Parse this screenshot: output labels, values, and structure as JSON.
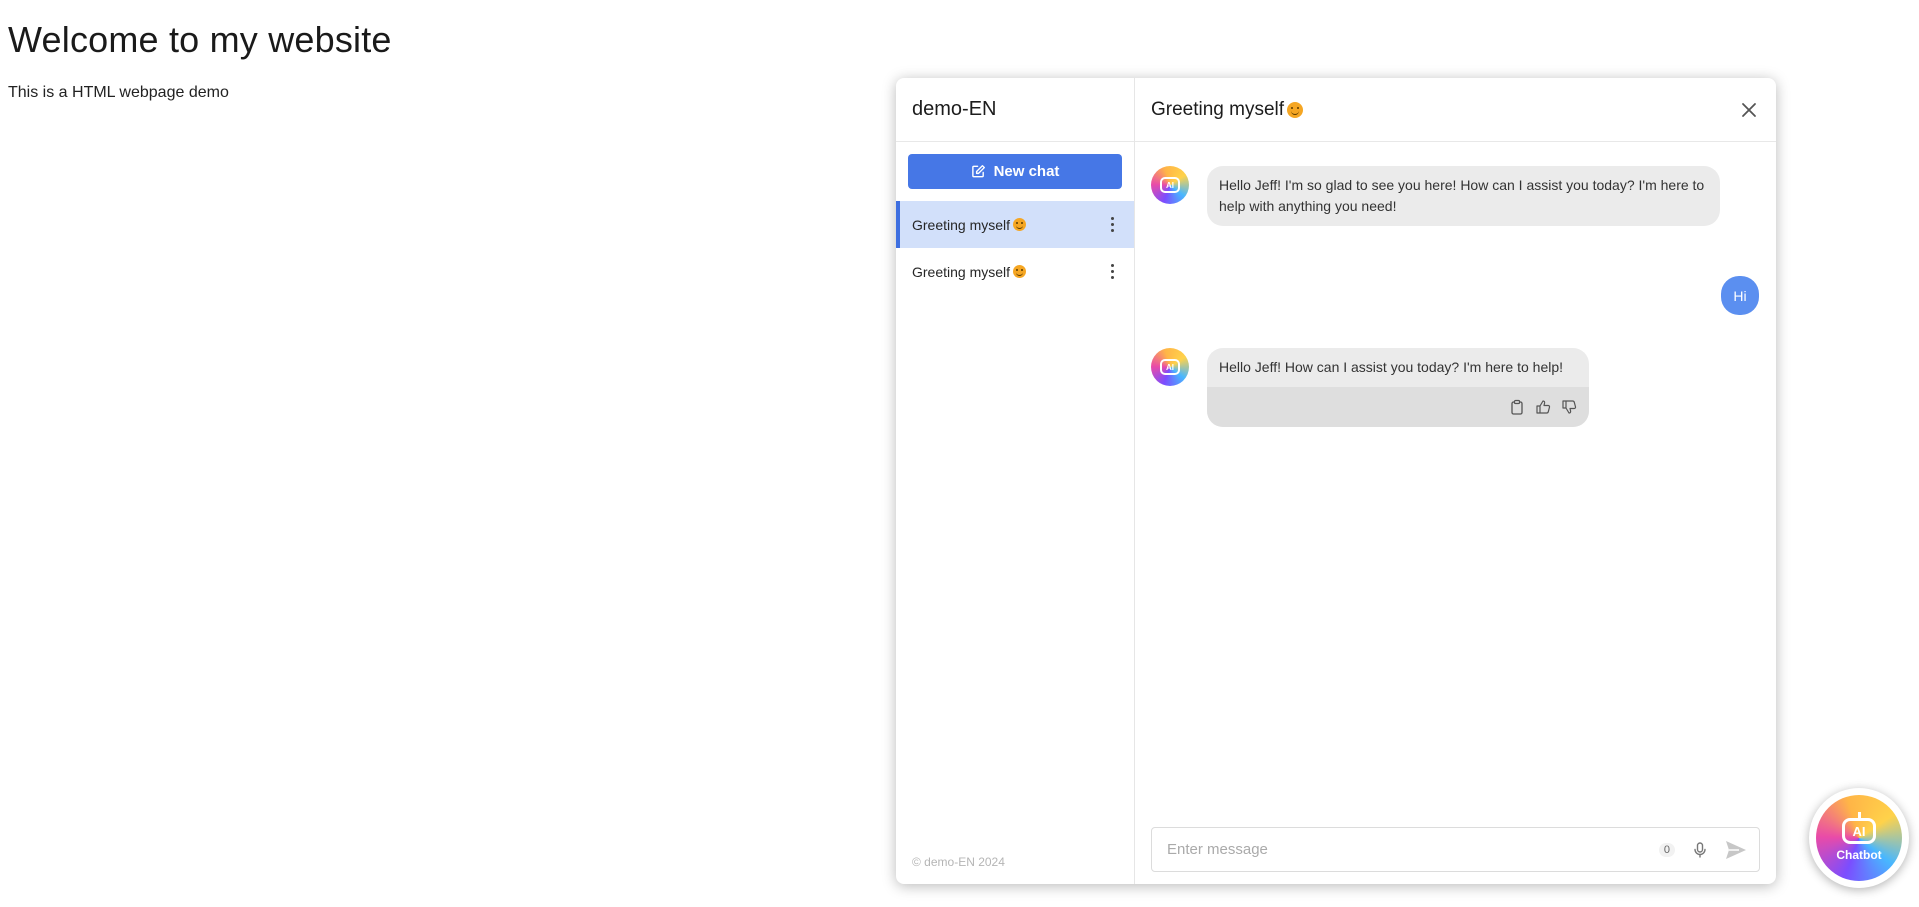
{
  "page": {
    "title": "Welcome to my website",
    "text": "This is a HTML webpage demo"
  },
  "sidebar": {
    "title": "demo-EN",
    "new_chat_label": "New chat",
    "conversations": [
      {
        "label": "Greeting myself",
        "active": true
      },
      {
        "label": "Greeting myself",
        "active": false
      }
    ],
    "footer": "© demo-EN 2024"
  },
  "chat": {
    "title": "Greeting myself",
    "messages": [
      {
        "role": "bot",
        "text": "Hello Jeff! I'm so glad to see you here! How can I assist you today? I'm here to help with anything you need!"
      },
      {
        "role": "user",
        "text": "Hi"
      },
      {
        "role": "bot",
        "text": "Hello Jeff! How can I assist you today? I'm here to help!"
      }
    ],
    "avatar_text": "AI"
  },
  "input": {
    "placeholder": "Enter message",
    "char_count": "0"
  },
  "fab": {
    "icon_text": "AI",
    "label": "Chatbot"
  },
  "colors": {
    "accent": "#4677e6",
    "user_bubble": "#5b8ff0",
    "active_item": "#d2e0fa"
  },
  "icons": [
    "edit-icon",
    "more-vertical-icon",
    "close-icon",
    "copy-icon",
    "thumbs-up-icon",
    "thumbs-down-icon",
    "mic-icon",
    "send-icon",
    "emoji-icon"
  ]
}
